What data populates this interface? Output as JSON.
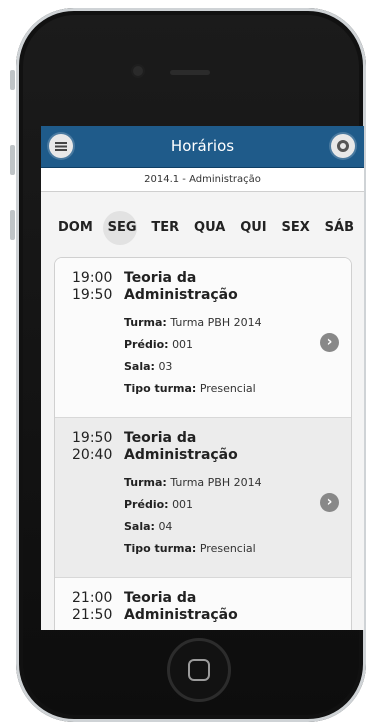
{
  "header": {
    "title": "Horários"
  },
  "subheader": {
    "text": "2014.1 - Administração"
  },
  "days": [
    "DOM",
    "SEG",
    "TER",
    "QUA",
    "QUI",
    "SEX",
    "SÁB"
  ],
  "selected_day": "SEG",
  "classes": [
    {
      "start": "19:00",
      "end": "19:50",
      "subject_line1": "Teoria da",
      "subject_line2": "Administração",
      "turma_label": "Turma:",
      "turma": "Turma PBH 2014",
      "predio_label": "Prédio:",
      "predio": "001",
      "sala_label": "Sala:",
      "sala": "03",
      "tipo_label": "Tipo turma:",
      "tipo": "Presencial"
    },
    {
      "start": "19:50",
      "end": "20:40",
      "subject_line1": "Teoria da",
      "subject_line2": "Administração",
      "turma_label": "Turma:",
      "turma": "Turma PBH 2014",
      "predio_label": "Prédio:",
      "predio": "001",
      "sala_label": "Sala:",
      "sala": "04",
      "tipo_label": "Tipo turma:",
      "tipo": "Presencial"
    },
    {
      "start": "21:00",
      "end": "21:50",
      "subject_line1": "Teoria da",
      "subject_line2": "Administração"
    }
  ],
  "icons": {
    "menu": "menu-icon",
    "settings": "gear-icon",
    "detail": "chevron-right-icon"
  },
  "colors": {
    "header": "#1f5b8a",
    "background": "#f4f4f4"
  }
}
